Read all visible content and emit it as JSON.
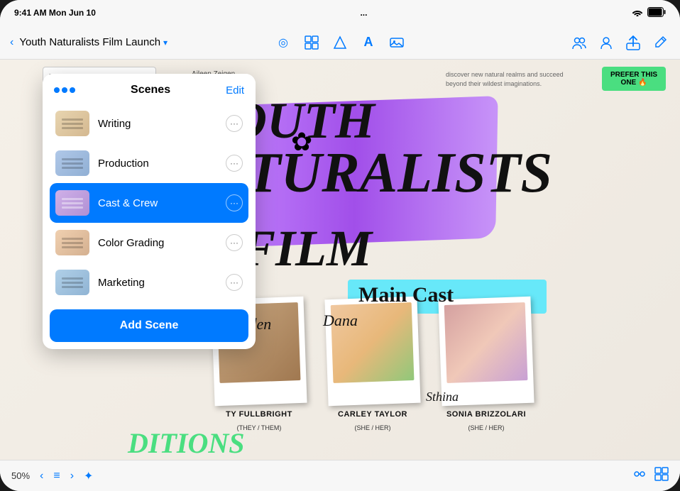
{
  "status_bar": {
    "time": "9:41 AM Mon Jun 10",
    "dots": "...",
    "wifi": "WiFi",
    "battery": "100%"
  },
  "toolbar": {
    "back_label": "‹",
    "title": "Youth Naturalists Film Launch",
    "title_arrow": "▾",
    "icons": {
      "circle_a": "◎",
      "layout": "⊞",
      "shapes": "⬡",
      "text": "A",
      "media": "⊡",
      "collab": "👥",
      "person": "👤",
      "share": "↑",
      "pencil": "✎"
    }
  },
  "scenes_panel": {
    "title": "Scenes",
    "edit_label": "Edit",
    "items": [
      {
        "id": "writing",
        "name": "Writing",
        "active": false
      },
      {
        "id": "production",
        "name": "Production",
        "active": false
      },
      {
        "id": "cast-crew",
        "name": "Cast & Crew",
        "active": true
      },
      {
        "id": "color-grading",
        "name": "Color Grading",
        "active": false
      },
      {
        "id": "marketing",
        "name": "Marketing",
        "active": false
      }
    ],
    "add_scene_label": "Add Scene"
  },
  "canvas": {
    "aileen_name": "Aileen Zeigen",
    "discover_text": "discover new natural realms and succeed beyond their wildest imaginations.",
    "youth_label": "YOUTH",
    "naturalists_label": "NATURALISTS",
    "film_label": "FILM",
    "main_cast_label": "Main Cast",
    "note_text": "PREFER THIS ONE 🔥",
    "cast": [
      {
        "signature": "Jayden",
        "name": "TY FULLBRIGHT",
        "pronouns": "(THEY / THEM)"
      },
      {
        "signature": "Dana",
        "name": "CARLEY TAYLOR",
        "pronouns": "(SHE / HER)"
      },
      {
        "signature": "Athina",
        "name": "SONIA BRIZZOLARI",
        "pronouns": "(SHE / HER)"
      }
    ],
    "bottom_text": "DITIONS"
  },
  "bottom_bar": {
    "zoom": "50%",
    "prev": "‹",
    "list": "≡",
    "next": "›",
    "star_page": "✦"
  }
}
